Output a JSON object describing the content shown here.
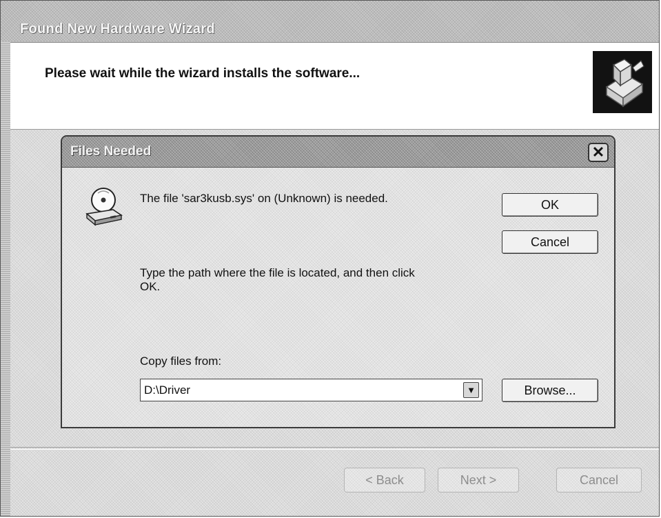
{
  "wizard": {
    "title": "Found New Hardware Wizard",
    "header_text": "Please wait while the wizard installs the software...",
    "header_icon": "hardware-install-icon",
    "buttons": {
      "back": "< Back",
      "next": "Next >",
      "cancel": "Cancel"
    }
  },
  "dialog": {
    "title": "Files Needed",
    "close_icon": "close-icon",
    "disk_icon": "cd-drive-icon",
    "message": "The file 'sar3kusb.sys' on (Unknown) is needed.",
    "instruction_line1": "Type the path where the file is located, and then click",
    "instruction_line2": "OK.",
    "copy_label": "Copy files from:",
    "path_value": "D:\\Driver",
    "buttons": {
      "ok": "OK",
      "cancel": "Cancel",
      "browse": "Browse..."
    }
  }
}
